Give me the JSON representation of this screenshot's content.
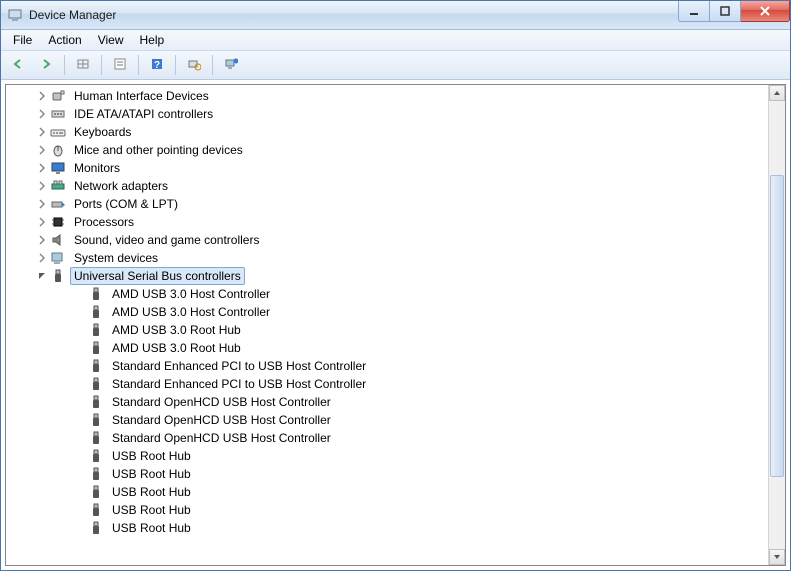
{
  "window": {
    "title": "Device Manager"
  },
  "menus": [
    "File",
    "Action",
    "View",
    "Help"
  ],
  "toolbar": {
    "items": [
      {
        "name": "back-button",
        "icon": "arrow-left"
      },
      {
        "name": "forward-button",
        "icon": "arrow-right"
      },
      {
        "sep": true
      },
      {
        "name": "show-hidden-button",
        "icon": "table"
      },
      {
        "sep": true
      },
      {
        "name": "properties-button",
        "icon": "props"
      },
      {
        "sep": true
      },
      {
        "name": "help-button",
        "icon": "help"
      },
      {
        "sep": true
      },
      {
        "name": "scan-hardware-button",
        "icon": "scan"
      },
      {
        "sep": true
      },
      {
        "name": "uninstall-button",
        "icon": "uninstall"
      }
    ]
  },
  "tree": {
    "categories": [
      {
        "label": "Human Interface Devices",
        "icon": "hid"
      },
      {
        "label": "IDE ATA/ATAPI controllers",
        "icon": "ide"
      },
      {
        "label": "Keyboards",
        "icon": "keyboard"
      },
      {
        "label": "Mice and other pointing devices",
        "icon": "mouse"
      },
      {
        "label": "Monitors",
        "icon": "monitor"
      },
      {
        "label": "Network adapters",
        "icon": "net"
      },
      {
        "label": "Ports (COM & LPT)",
        "icon": "port"
      },
      {
        "label": "Processors",
        "icon": "cpu"
      },
      {
        "label": "Sound, video and game controllers",
        "icon": "sound"
      },
      {
        "label": "System devices",
        "icon": "system"
      }
    ],
    "expanded": {
      "label": "Universal Serial Bus controllers",
      "icon": "usb-cat",
      "selected": true,
      "children": [
        "AMD USB 3.0 Host Controller",
        "AMD USB 3.0 Host Controller",
        "AMD USB 3.0 Root Hub",
        "AMD USB 3.0 Root Hub",
        "Standard Enhanced PCI to USB Host Controller",
        "Standard Enhanced PCI to USB Host Controller",
        "Standard OpenHCD USB Host Controller",
        "Standard OpenHCD USB Host Controller",
        "Standard OpenHCD USB Host Controller",
        "USB Root Hub",
        "USB Root Hub",
        "USB Root Hub",
        "USB Root Hub",
        "USB Root Hub"
      ]
    }
  }
}
